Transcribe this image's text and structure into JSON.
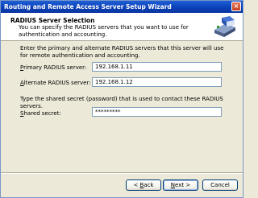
{
  "window": {
    "title": "Routing and Remote Access Server Setup Wizard",
    "close_glyph": "×"
  },
  "header": {
    "title": "RADIUS Server Selection",
    "subtitle": "You can specify the RADIUS servers that you want to use for authentication and accounting.",
    "icon": "network-server-icon"
  },
  "main": {
    "intro": "Enter the primary and alternate RADIUS servers that this server will use for remote authentication and accounting.",
    "primary": {
      "label_pre": "",
      "label_key": "P",
      "label_post": "rimary RADIUS server:",
      "value": "192.168.1.11"
    },
    "alternate": {
      "label_pre": "",
      "label_key": "A",
      "label_post": "lternate RADIUS server:",
      "value": "192.168.1.12"
    },
    "secret_intro": "Type the shared secret (password) that is used to contact these RADIUS servers.",
    "secret": {
      "label_pre": "",
      "label_key": "S",
      "label_post": "hared secret:",
      "value": "*********"
    }
  },
  "buttons": {
    "back_pre": "< ",
    "back_key": "B",
    "back_post": "ack",
    "next_pre": "",
    "next_key": "N",
    "next_post": "ext >",
    "cancel": "Cancel"
  }
}
